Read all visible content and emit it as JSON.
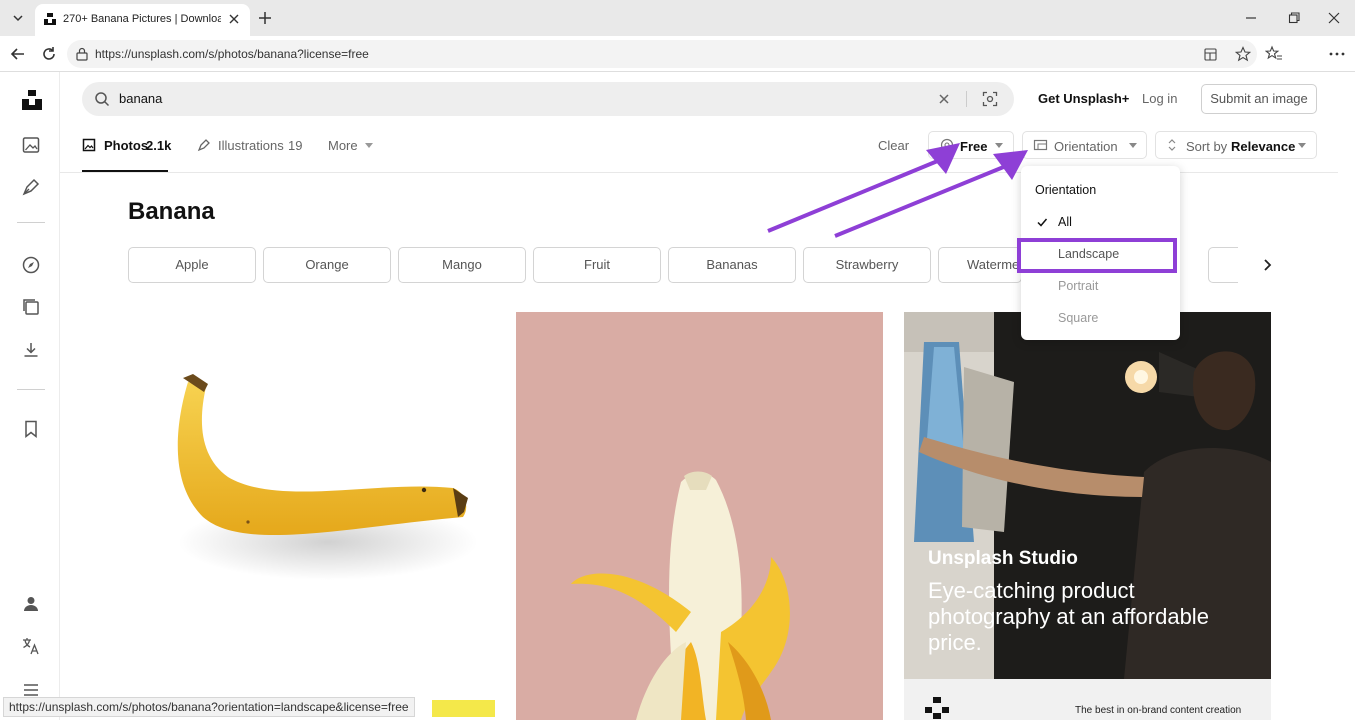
{
  "browser": {
    "tab_title": "270+ Banana Pictures | Download",
    "url": "https://unsplash.com/s/photos/banana?license=free",
    "status_url": "https://unsplash.com/s/photos/banana?orientation=landscape&license=free"
  },
  "search": {
    "query": "banana"
  },
  "header": {
    "get_plus": "Get Unsplash+",
    "login": "Log in",
    "submit": "Submit an image"
  },
  "tabs": {
    "photos_label": "Photos",
    "photos_count": "2.1k",
    "illustrations_label": "Illustrations",
    "illustrations_count": "19",
    "more": "More"
  },
  "filters": {
    "clear": "Clear",
    "license": "Free",
    "orientation": "Orientation",
    "sort_prefix": "Sort by",
    "sort_value": "Relevance"
  },
  "page_title": "Banana",
  "chips": [
    "Apple",
    "Orange",
    "Mango",
    "Fruit",
    "Bananas",
    "Strawberry",
    "Waterme"
  ],
  "dropdown": {
    "title": "Orientation",
    "items": [
      "All",
      "Landscape",
      "Portrait",
      "Square"
    ],
    "selected": "All",
    "highlighted": "Landscape"
  },
  "ad": {
    "brand": "Unsplash Studio",
    "headline": "Eye-catching product photography at an affordable price.",
    "footer": "The best in on-brand content creation"
  },
  "colors": {
    "annotation": "#8e3fd6",
    "accent_text": "#111111",
    "muted": "#767676"
  }
}
